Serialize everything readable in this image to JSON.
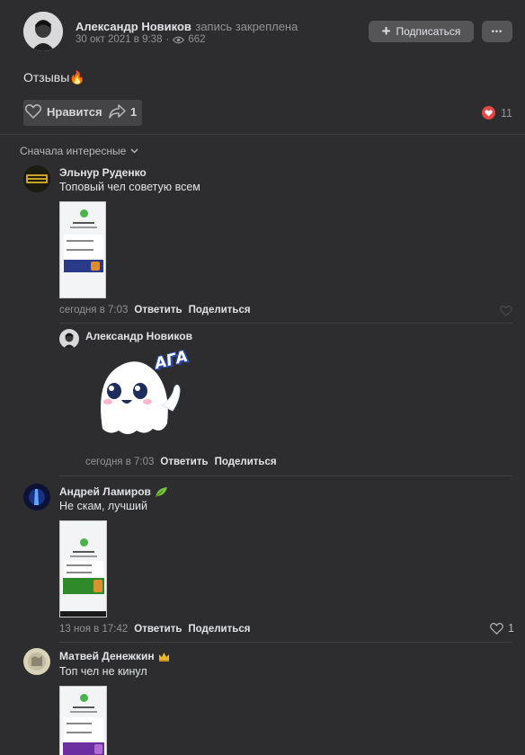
{
  "post": {
    "author": "Александр Новиков",
    "pinned_label": "запись закреплена",
    "date": "30 окт 2021 в 9:38",
    "views": "662",
    "subscribe_label": "Подписаться",
    "more_label": "•••",
    "text": "Отзывы🔥",
    "like_label": "Нравится",
    "share_count": "1",
    "likes_count": "11"
  },
  "comments_header": {
    "sort_label": "Сначала интересные"
  },
  "comments": [
    {
      "name": "Эльнур Руденко",
      "text": "Топовый чел советую всем",
      "time": "сегодня в 7:03",
      "reply_label": "Ответить",
      "share_label": "Поделиться"
    },
    {
      "name": "Андрей Ламиров",
      "text": "Не скам, лучший",
      "time": "13 ноя в 17:42",
      "reply_label": "Ответить",
      "share_label": "Поделиться",
      "likes": "1"
    },
    {
      "name": "Матвей Денежкин",
      "text": "Топ чел не кинул"
    }
  ],
  "reply": {
    "name": "Александр Новиков",
    "sticker_text": "АГА",
    "time": "сегодня в 7:03",
    "reply_label": "Ответить",
    "share_label": "Поделиться"
  },
  "colors": {
    "background": "#2d2d2f",
    "button": "#555558",
    "heart_badge": "#e64646",
    "success_green": "#4bb34b"
  }
}
